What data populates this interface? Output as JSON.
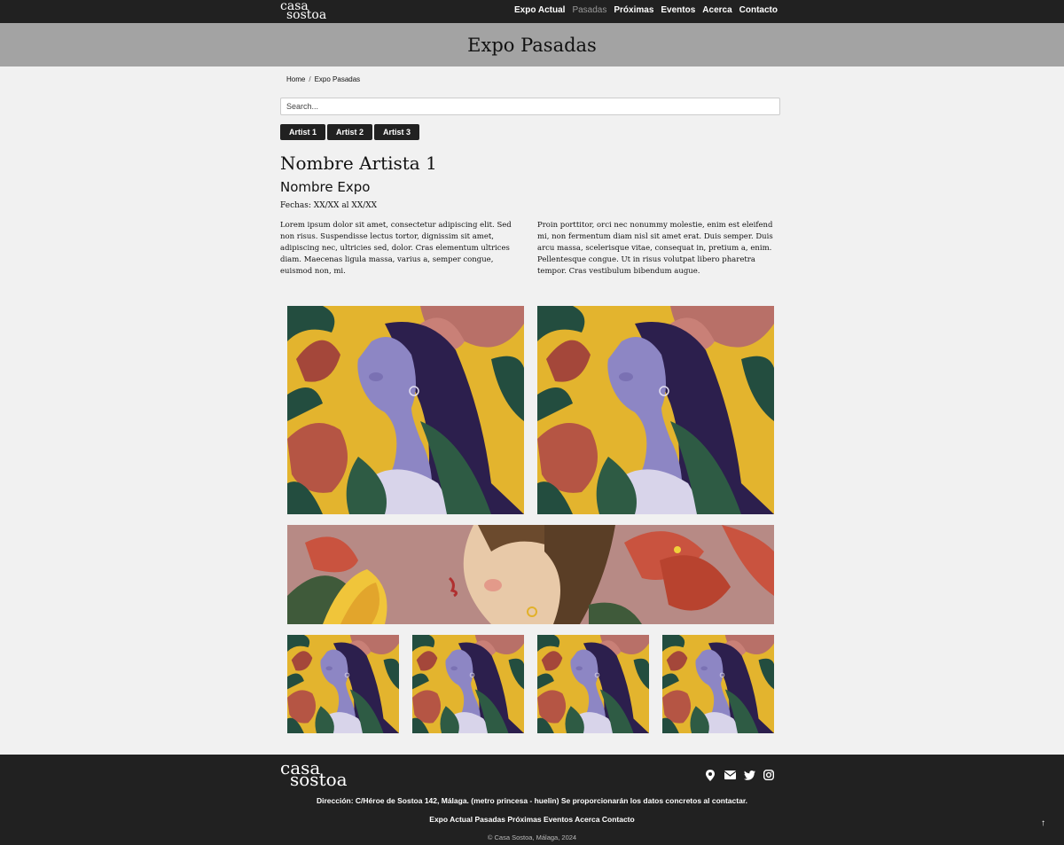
{
  "nav": {
    "brand_line1": "casa",
    "brand_line2": "sostoa",
    "items": [
      "Expo Actual",
      "Pasadas",
      "Próximas",
      "Eventos",
      "Acerca",
      "Contacto"
    ],
    "active": "Pasadas"
  },
  "banner": {
    "title": "Expo Pasadas"
  },
  "breadcrumb": {
    "home": "Home",
    "separator": "/",
    "current": "Expo Pasadas"
  },
  "search": {
    "placeholder": "Search...",
    "value": ""
  },
  "artists": [
    "Artist 1",
    "Artist 2",
    "Artist 3"
  ],
  "content": {
    "artist_name": "Nombre Artista 1",
    "expo_name": "Nombre Expo",
    "dates": "Fechas: XX/XX al XX/XX",
    "paragraph_1": "Lorem ipsum dolor sit amet, consectetur adipiscing elit. Sed non risus. Suspendisse lectus tortor, dignissim sit amet, adipiscing nec, ultricies sed, dolor. Cras elementum ultrices diam. Maecenas ligula massa, varius a, semper congue, euismod non, mi.",
    "paragraph_2": "Proin porttitor, orci nec nonummy molestie, enim est eleifend mi, non fermentum diam nisl sit amet erat. Duis semper. Duis arcu massa, scelerisque vitae, consequat in, pretium a, enim. Pellentesque congue. Ut in risus volutpat libero pharetra tempor. Cras vestibulum bibendum augue."
  },
  "colors": {
    "nav_bg": "#212121",
    "banner_bg": "#a3a3a3",
    "page_bg": "#f1f1f1",
    "art_yellow": "#e3b42e",
    "art_pink": "#b78a85"
  },
  "footer": {
    "brand_line1": "casa",
    "brand_line2": "sostoa",
    "social_icons": [
      "map-pin-icon",
      "envelope-icon",
      "twitter-icon",
      "instagram-icon"
    ],
    "address": "Dirección: C/Héroe de Sostoa 142, Málaga. (metro princesa - huelin) Se proporcionarán los datos concretos al contactar.",
    "links": [
      "Expo Actual",
      "Pasadas",
      "Próximas",
      "Eventos",
      "Acerca",
      "Contacto"
    ],
    "copyright": "© Casa Sostoa, Málaga, 2024",
    "back_to_top": "↑"
  }
}
